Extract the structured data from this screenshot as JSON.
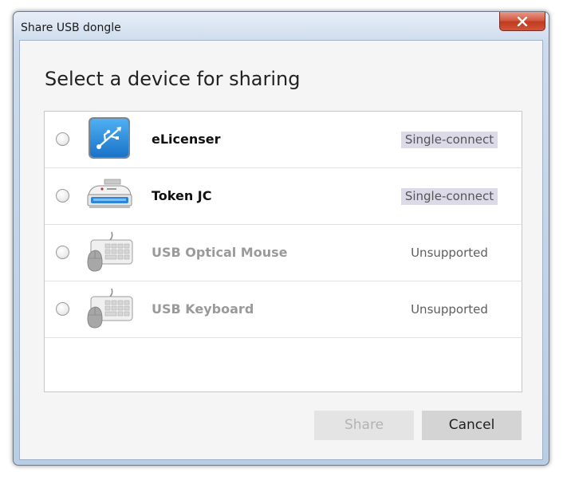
{
  "window": {
    "title": "Share USB dongle"
  },
  "dialog": {
    "heading": "Select a device for sharing"
  },
  "devices": [
    {
      "name": "eLicenser",
      "status": "Single-connect",
      "icon": "usb-icon",
      "enabled": true,
      "selected": false
    },
    {
      "name": "Token JC",
      "status": "Single-connect",
      "icon": "card-reader-icon",
      "enabled": true,
      "selected": false
    },
    {
      "name": "USB Optical Mouse",
      "status": "Unsupported",
      "icon": "keyboard-mouse-icon",
      "enabled": false,
      "selected": false
    },
    {
      "name": "USB Keyboard",
      "status": "Unsupported",
      "icon": "keyboard-mouse-icon",
      "enabled": false,
      "selected": false
    }
  ],
  "buttons": {
    "share_label": "Share",
    "cancel_label": "Cancel"
  },
  "colors": {
    "badge_background": "#dcd9e8",
    "close_button": "#c8452a",
    "usb_icon_blue": "#2a8ad8"
  }
}
